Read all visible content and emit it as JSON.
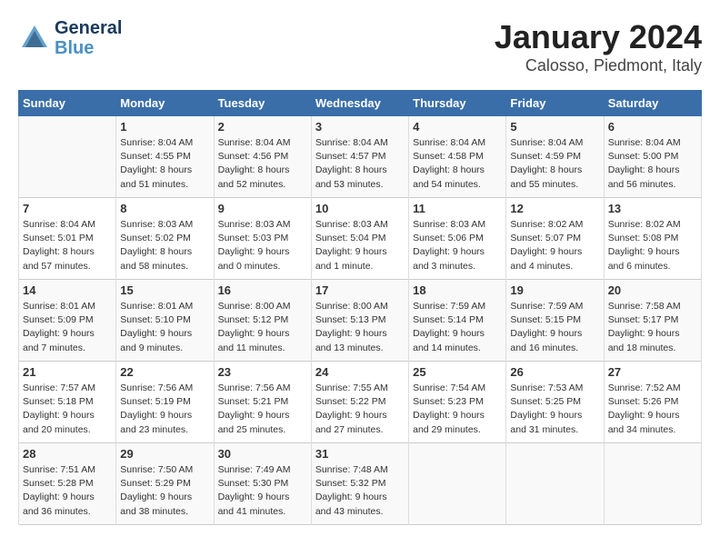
{
  "header": {
    "logo_line1": "General",
    "logo_line2": "Blue",
    "title": "January 2024",
    "subtitle": "Calosso, Piedmont, Italy"
  },
  "days_of_week": [
    "Sunday",
    "Monday",
    "Tuesday",
    "Wednesday",
    "Thursday",
    "Friday",
    "Saturday"
  ],
  "weeks": [
    [
      {
        "day": "",
        "content": ""
      },
      {
        "day": "1",
        "content": "Sunrise: 8:04 AM\nSunset: 4:55 PM\nDaylight: 8 hours\nand 51 minutes."
      },
      {
        "day": "2",
        "content": "Sunrise: 8:04 AM\nSunset: 4:56 PM\nDaylight: 8 hours\nand 52 minutes."
      },
      {
        "day": "3",
        "content": "Sunrise: 8:04 AM\nSunset: 4:57 PM\nDaylight: 8 hours\nand 53 minutes."
      },
      {
        "day": "4",
        "content": "Sunrise: 8:04 AM\nSunset: 4:58 PM\nDaylight: 8 hours\nand 54 minutes."
      },
      {
        "day": "5",
        "content": "Sunrise: 8:04 AM\nSunset: 4:59 PM\nDaylight: 8 hours\nand 55 minutes."
      },
      {
        "day": "6",
        "content": "Sunrise: 8:04 AM\nSunset: 5:00 PM\nDaylight: 8 hours\nand 56 minutes."
      }
    ],
    [
      {
        "day": "7",
        "content": "Sunrise: 8:04 AM\nSunset: 5:01 PM\nDaylight: 8 hours\nand 57 minutes."
      },
      {
        "day": "8",
        "content": "Sunrise: 8:03 AM\nSunset: 5:02 PM\nDaylight: 8 hours\nand 58 minutes."
      },
      {
        "day": "9",
        "content": "Sunrise: 8:03 AM\nSunset: 5:03 PM\nDaylight: 9 hours\nand 0 minutes."
      },
      {
        "day": "10",
        "content": "Sunrise: 8:03 AM\nSunset: 5:04 PM\nDaylight: 9 hours\nand 1 minute."
      },
      {
        "day": "11",
        "content": "Sunrise: 8:03 AM\nSunset: 5:06 PM\nDaylight: 9 hours\nand 3 minutes."
      },
      {
        "day": "12",
        "content": "Sunrise: 8:02 AM\nSunset: 5:07 PM\nDaylight: 9 hours\nand 4 minutes."
      },
      {
        "day": "13",
        "content": "Sunrise: 8:02 AM\nSunset: 5:08 PM\nDaylight: 9 hours\nand 6 minutes."
      }
    ],
    [
      {
        "day": "14",
        "content": "Sunrise: 8:01 AM\nSunset: 5:09 PM\nDaylight: 9 hours\nand 7 minutes."
      },
      {
        "day": "15",
        "content": "Sunrise: 8:01 AM\nSunset: 5:10 PM\nDaylight: 9 hours\nand 9 minutes."
      },
      {
        "day": "16",
        "content": "Sunrise: 8:00 AM\nSunset: 5:12 PM\nDaylight: 9 hours\nand 11 minutes."
      },
      {
        "day": "17",
        "content": "Sunrise: 8:00 AM\nSunset: 5:13 PM\nDaylight: 9 hours\nand 13 minutes."
      },
      {
        "day": "18",
        "content": "Sunrise: 7:59 AM\nSunset: 5:14 PM\nDaylight: 9 hours\nand 14 minutes."
      },
      {
        "day": "19",
        "content": "Sunrise: 7:59 AM\nSunset: 5:15 PM\nDaylight: 9 hours\nand 16 minutes."
      },
      {
        "day": "20",
        "content": "Sunrise: 7:58 AM\nSunset: 5:17 PM\nDaylight: 9 hours\nand 18 minutes."
      }
    ],
    [
      {
        "day": "21",
        "content": "Sunrise: 7:57 AM\nSunset: 5:18 PM\nDaylight: 9 hours\nand 20 minutes."
      },
      {
        "day": "22",
        "content": "Sunrise: 7:56 AM\nSunset: 5:19 PM\nDaylight: 9 hours\nand 23 minutes."
      },
      {
        "day": "23",
        "content": "Sunrise: 7:56 AM\nSunset: 5:21 PM\nDaylight: 9 hours\nand 25 minutes."
      },
      {
        "day": "24",
        "content": "Sunrise: 7:55 AM\nSunset: 5:22 PM\nDaylight: 9 hours\nand 27 minutes."
      },
      {
        "day": "25",
        "content": "Sunrise: 7:54 AM\nSunset: 5:23 PM\nDaylight: 9 hours\nand 29 minutes."
      },
      {
        "day": "26",
        "content": "Sunrise: 7:53 AM\nSunset: 5:25 PM\nDaylight: 9 hours\nand 31 minutes."
      },
      {
        "day": "27",
        "content": "Sunrise: 7:52 AM\nSunset: 5:26 PM\nDaylight: 9 hours\nand 34 minutes."
      }
    ],
    [
      {
        "day": "28",
        "content": "Sunrise: 7:51 AM\nSunset: 5:28 PM\nDaylight: 9 hours\nand 36 minutes."
      },
      {
        "day": "29",
        "content": "Sunrise: 7:50 AM\nSunset: 5:29 PM\nDaylight: 9 hours\nand 38 minutes."
      },
      {
        "day": "30",
        "content": "Sunrise: 7:49 AM\nSunset: 5:30 PM\nDaylight: 9 hours\nand 41 minutes."
      },
      {
        "day": "31",
        "content": "Sunrise: 7:48 AM\nSunset: 5:32 PM\nDaylight: 9 hours\nand 43 minutes."
      },
      {
        "day": "",
        "content": ""
      },
      {
        "day": "",
        "content": ""
      },
      {
        "day": "",
        "content": ""
      }
    ]
  ]
}
